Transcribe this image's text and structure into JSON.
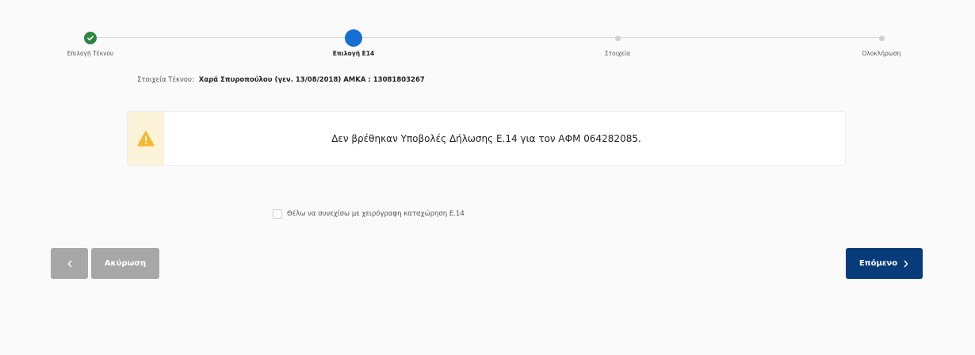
{
  "stepper": {
    "steps": [
      {
        "label": "Επιλογή Τέκνου",
        "state": "done"
      },
      {
        "label": "Επιλογή Ε14",
        "state": "active"
      },
      {
        "label": "Στοιχεία",
        "state": "pending"
      },
      {
        "label": "Ολοκλήρωση",
        "state": "pending"
      }
    ],
    "colors": {
      "done": "#2e8540",
      "active": "#1670d2",
      "pending": "#cfcfcf"
    }
  },
  "child_info": {
    "label": "Στοιχεία Τέκνου:",
    "value": "Χαρά Σπυροπούλου (γεν. 13/08/2018) ΑΜΚΑ : 13081803267"
  },
  "alert": {
    "icon": "warning-icon",
    "message": "Δεν βρέθηκαν Υποβολές Δήλωσης Ε.14 για τον ΑΦΜ 064282085.",
    "icon_color": "#f5b82e"
  },
  "manual_entry": {
    "label": "Θέλω να συνεχίσω με χειρόγραφη καταχώρηση Ε.14",
    "checked": false
  },
  "buttons": {
    "back_icon": "chevron-left-icon",
    "cancel_label": "Ακύρωση",
    "next_label": "Επόμενο",
    "next_icon": "chevron-right-icon",
    "next_color": "#073b7a",
    "disabled_color": "#a7a7a7"
  }
}
